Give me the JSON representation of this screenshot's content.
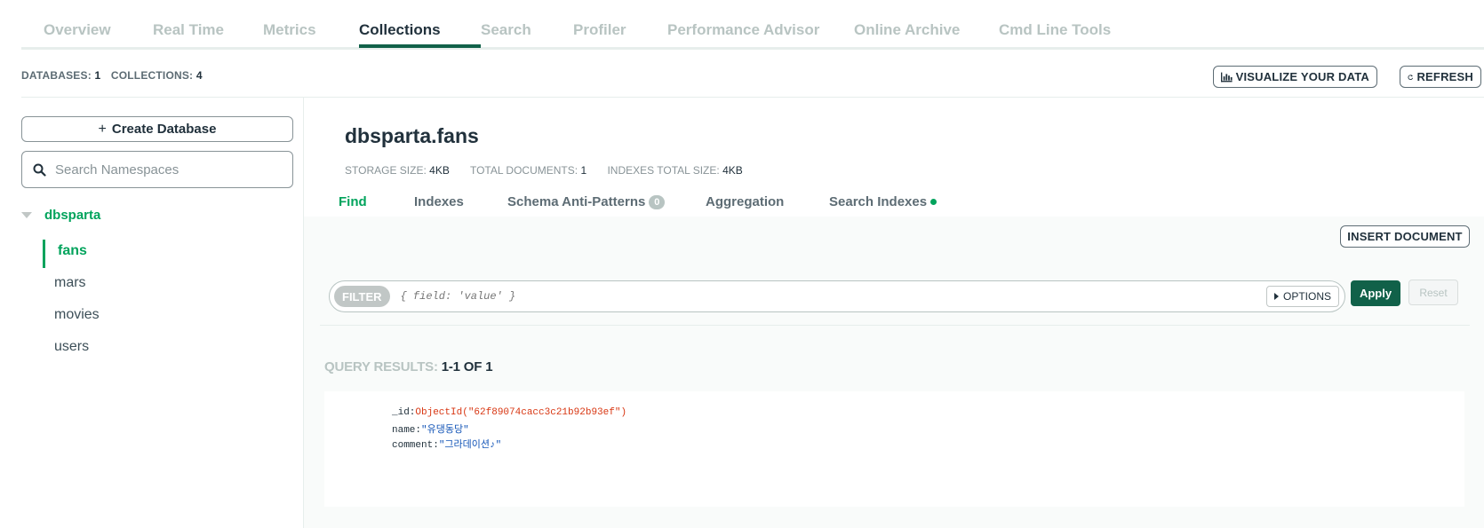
{
  "top_tabs": [
    {
      "label": "Overview"
    },
    {
      "label": "Real Time"
    },
    {
      "label": "Metrics"
    },
    {
      "label": "Collections"
    },
    {
      "label": "Search"
    },
    {
      "label": "Profiler"
    },
    {
      "label": "Performance Advisor"
    },
    {
      "label": "Online Archive"
    },
    {
      "label": "Cmd Line Tools"
    }
  ],
  "active_tab": "Collections",
  "stats": {
    "databases_label": "DATABASES:",
    "databases_value": "1",
    "collections_label": "COLLECTIONS:",
    "collections_value": "4"
  },
  "actions": {
    "visualize_label": "VISUALIZE YOUR DATA",
    "refresh_label": "REFRESH"
  },
  "sidebar": {
    "create_db_label": "Create Database",
    "search_placeholder": "Search Namespaces",
    "database": "dbsparta",
    "collections": [
      {
        "name": "fans"
      },
      {
        "name": "mars"
      },
      {
        "name": "movies"
      },
      {
        "name": "users"
      }
    ],
    "active_collection": "fans"
  },
  "namespace": {
    "title": "dbsparta.fans",
    "storage_label": "STORAGE SIZE:",
    "storage_value": "4KB",
    "docs_label": "TOTAL DOCUMENTS:",
    "docs_value": "1",
    "indexes_label": "INDEXES TOTAL SIZE:",
    "indexes_value": "4KB"
  },
  "sub_tabs": {
    "find": "Find",
    "indexes": "Indexes",
    "schema": "Schema Anti-Patterns",
    "schema_count": "0",
    "aggregation": "Aggregation",
    "search_indexes": "Search Indexes"
  },
  "toolbar": {
    "insert_label": "INSERT DOCUMENT",
    "filter_label": "FILTER",
    "filter_placeholder": "{ field: 'value' }",
    "options_label": "OPTIONS",
    "apply_label": "Apply",
    "reset_label": "Reset"
  },
  "results": {
    "label": "QUERY RESULTS:",
    "value": "1-1 OF 1"
  },
  "document": {
    "id_key": "_id:",
    "id_value": "ObjectId(\"62f89074cacc3c21b92b93ef\")",
    "name_key": "name:",
    "name_value": "\"유댕동당\"",
    "comment_key": "comment:",
    "comment_value": "\"그라데이션♪\""
  },
  "colors": {
    "accent_green": "#00a35c",
    "apply_green": "#116149",
    "objectid_red": "#d83713",
    "string_blue": "#1254b7"
  }
}
